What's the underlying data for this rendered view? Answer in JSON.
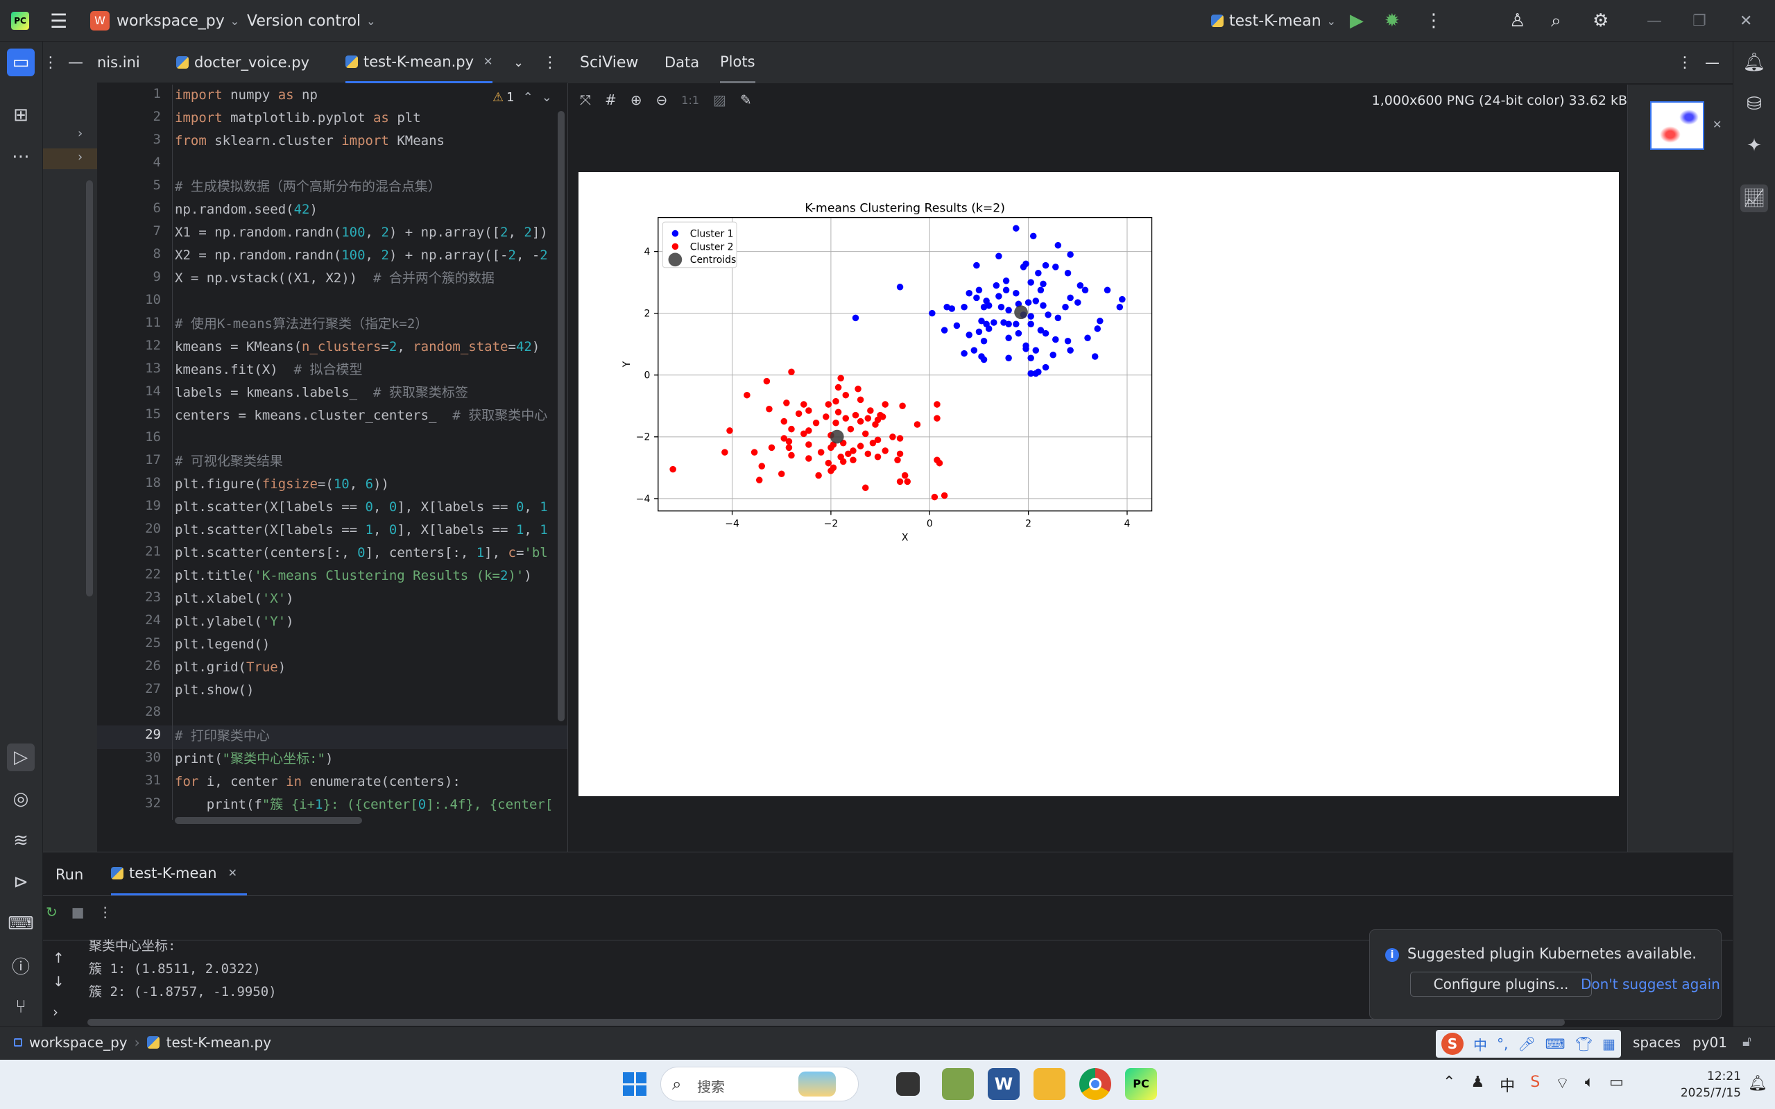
{
  "titlebar": {
    "project": "workspace_py",
    "project_badge": "W",
    "vcs": "Version control",
    "run_config": "test-K-mean"
  },
  "editor_tabs": [
    {
      "label": "nis.ini"
    },
    {
      "label": "docter_voice.py"
    },
    {
      "label": "test-K-mean.py"
    }
  ],
  "editor": {
    "warning_count": "1",
    "lines": [
      {
        "n": "1",
        "t": "import numpy as np"
      },
      {
        "n": "2",
        "t": "import matplotlib.pyplot as plt"
      },
      {
        "n": "3",
        "t": "from sklearn.cluster import KMeans"
      },
      {
        "n": "4",
        "t": ""
      },
      {
        "n": "5",
        "t": "# 生成模拟数据（两个高斯分布的混合点集）"
      },
      {
        "n": "6",
        "t": "np.random.seed(42)"
      },
      {
        "n": "7",
        "t": "X1 = np.random.randn(100, 2) + np.array([2, 2])"
      },
      {
        "n": "8",
        "t": "X2 = np.random.randn(100, 2) + np.array([-2, -2"
      },
      {
        "n": "9",
        "t": "X = np.vstack((X1, X2))  # 合并两个簇的数据"
      },
      {
        "n": "10",
        "t": ""
      },
      {
        "n": "11",
        "t": "# 使用K-means算法进行聚类（指定k=2）"
      },
      {
        "n": "12",
        "t": "kmeans = KMeans(n_clusters=2, random_state=42)"
      },
      {
        "n": "13",
        "t": "kmeans.fit(X)  # 拟合模型"
      },
      {
        "n": "14",
        "t": "labels = kmeans.labels_  # 获取聚类标签"
      },
      {
        "n": "15",
        "t": "centers = kmeans.cluster_centers_  # 获取聚类中心"
      },
      {
        "n": "16",
        "t": ""
      },
      {
        "n": "17",
        "t": "# 可视化聚类结果"
      },
      {
        "n": "18",
        "t": "plt.figure(figsize=(10, 6))"
      },
      {
        "n": "19",
        "t": "plt.scatter(X[labels == 0, 0], X[labels == 0, 1"
      },
      {
        "n": "20",
        "t": "plt.scatter(X[labels == 1, 0], X[labels == 1, 1"
      },
      {
        "n": "21",
        "t": "plt.scatter(centers[:, 0], centers[:, 1], c='bl"
      },
      {
        "n": "22",
        "t": "plt.title('K-means Clustering Results (k=2)')"
      },
      {
        "n": "23",
        "t": "plt.xlabel('X')"
      },
      {
        "n": "24",
        "t": "plt.ylabel('Y')"
      },
      {
        "n": "25",
        "t": "plt.legend()"
      },
      {
        "n": "26",
        "t": "plt.grid(True)"
      },
      {
        "n": "27",
        "t": "plt.show()"
      },
      {
        "n": "28",
        "t": ""
      },
      {
        "n": "29",
        "t": "# 打印聚类中心"
      },
      {
        "n": "30",
        "t": "print(\"聚类中心坐标:\")"
      },
      {
        "n": "31",
        "t": "for i, center in enumerate(centers):"
      },
      {
        "n": "32",
        "t": "    print(f\"簇 {i+1}: ({center[0]:.4f}, {center["
      }
    ]
  },
  "sciview": {
    "tabs": [
      "SciView",
      "Data",
      "Plots"
    ],
    "zoom_label": "1:1",
    "image_info": "1,000x600 PNG (24-bit color) 33.62 kB"
  },
  "chart_data": {
    "type": "scatter",
    "title": "K-means Clustering Results (k=2)",
    "xlabel": "X",
    "ylabel": "Y",
    "xlim": [
      -5.5,
      4.5
    ],
    "ylim": [
      -4.4,
      5.1
    ],
    "xticks": [
      -4,
      -2,
      0,
      2,
      4
    ],
    "yticks": [
      -4,
      -2,
      0,
      2,
      4
    ],
    "tick_labels_x": [
      "−4",
      "−2",
      "0",
      "2",
      "4"
    ],
    "tick_labels_y": [
      "−4",
      "−2",
      "0",
      "2",
      "4"
    ],
    "grid": true,
    "legend_position": "top-left",
    "series": [
      {
        "name": "Cluster 1",
        "color": "#0000ff",
        "points": [
          [
            1.75,
            4.75
          ],
          [
            2.1,
            4.5
          ],
          [
            2.6,
            4.2
          ],
          [
            2.85,
            3.9
          ],
          [
            1.4,
            3.85
          ],
          [
            1.95,
            3.6
          ],
          [
            2.35,
            3.55
          ],
          [
            2.55,
            3.5
          ],
          [
            0.95,
            3.55
          ],
          [
            1.9,
            3.5
          ],
          [
            2.2,
            3.3
          ],
          [
            2.8,
            3.3
          ],
          [
            1.55,
            3.05
          ],
          [
            2.05,
            3.0
          ],
          [
            2.3,
            2.95
          ],
          [
            3.05,
            2.9
          ],
          [
            1.35,
            2.9
          ],
          [
            3.15,
            2.75
          ],
          [
            3.6,
            2.75
          ],
          [
            1.0,
            2.75
          ],
          [
            1.55,
            2.75
          ],
          [
            2.25,
            2.75
          ],
          [
            1.75,
            2.65
          ],
          [
            0.8,
            2.65
          ],
          [
            1.4,
            2.55
          ],
          [
            2.85,
            2.5
          ],
          [
            0.95,
            2.5
          ],
          [
            1.15,
            2.4
          ],
          [
            2.15,
            2.4
          ],
          [
            2.0,
            2.35
          ],
          [
            3.0,
            2.35
          ],
          [
            1.8,
            2.3
          ],
          [
            1.2,
            2.25
          ],
          [
            2.3,
            2.25
          ],
          [
            0.7,
            2.2
          ],
          [
            1.1,
            2.2
          ],
          [
            0.35,
            2.2
          ],
          [
            1.45,
            2.2
          ],
          [
            2.75,
            2.2
          ],
          [
            0.45,
            2.15
          ],
          [
            3.85,
            2.2
          ],
          [
            1.6,
            2.1
          ],
          [
            3.9,
            2.45
          ],
          [
            0.05,
            2.0
          ],
          [
            1.9,
            1.95
          ],
          [
            2.4,
            1.95
          ],
          [
            2.05,
            1.9
          ],
          [
            2.6,
            1.85
          ],
          [
            1.05,
            1.75
          ],
          [
            1.3,
            1.7
          ],
          [
            1.6,
            1.65
          ],
          [
            1.75,
            1.65
          ],
          [
            2.05,
            1.65
          ],
          [
            3.45,
            1.75
          ],
          [
            1.15,
            1.65
          ],
          [
            1.5,
            1.7
          ],
          [
            0.55,
            1.6
          ],
          [
            1.2,
            1.5
          ],
          [
            2.25,
            1.45
          ],
          [
            0.3,
            1.45
          ],
          [
            1.0,
            1.4
          ],
          [
            1.8,
            1.35
          ],
          [
            2.35,
            1.35
          ],
          [
            3.4,
            1.5
          ],
          [
            0.8,
            1.3
          ],
          [
            1.6,
            1.2
          ],
          [
            2.55,
            1.15
          ],
          [
            1.1,
            1.1
          ],
          [
            2.8,
            1.1
          ],
          [
            3.2,
            1.2
          ],
          [
            1.95,
            0.95
          ],
          [
            0.9,
            0.8
          ],
          [
            1.95,
            0.85
          ],
          [
            2.15,
            0.8
          ],
          [
            2.85,
            0.8
          ],
          [
            0.7,
            0.7
          ],
          [
            1.05,
            0.6
          ],
          [
            2.5,
            0.65
          ],
          [
            3.35,
            0.6
          ],
          [
            1.6,
            0.55
          ],
          [
            2.05,
            0.55
          ],
          [
            1.1,
            0.5
          ],
          [
            2.35,
            0.25
          ],
          [
            2.2,
            0.1
          ],
          [
            2.05,
            0.05
          ],
          [
            2.15,
            0.05
          ],
          [
            -0.6,
            2.85
          ],
          [
            -1.5,
            1.85
          ]
        ]
      },
      {
        "name": "Cluster 2",
        "color": "#ff0000",
        "points": [
          [
            -2.8,
            0.1
          ],
          [
            -1.8,
            -0.1
          ],
          [
            -3.3,
            -0.2
          ],
          [
            -1.45,
            -0.45
          ],
          [
            -1.85,
            -0.4
          ],
          [
            -3.7,
            -0.65
          ],
          [
            -1.7,
            -0.65
          ],
          [
            -1.4,
            -0.8
          ],
          [
            -2.9,
            -0.9
          ],
          [
            -1.9,
            -0.85
          ],
          [
            -2.55,
            -0.95
          ],
          [
            -2.05,
            -0.95
          ],
          [
            -0.9,
            -0.95
          ],
          [
            0.15,
            -0.95
          ],
          [
            -0.55,
            -1.0
          ],
          [
            -3.25,
            -1.1
          ],
          [
            -2.45,
            -1.15
          ],
          [
            -1.2,
            -1.15
          ],
          [
            -1.85,
            -1.2
          ],
          [
            -2.65,
            -1.25
          ],
          [
            -1.5,
            -1.3
          ],
          [
            -1.0,
            -1.3
          ],
          [
            -2.1,
            -1.35
          ],
          [
            -1.7,
            -1.4
          ],
          [
            -1.25,
            -1.4
          ],
          [
            -1.05,
            -1.45
          ],
          [
            -0.95,
            -1.35
          ],
          [
            -1.4,
            -1.5
          ],
          [
            -2.95,
            -1.5
          ],
          [
            -2.3,
            -1.55
          ],
          [
            -1.9,
            -1.55
          ],
          [
            -1.1,
            -1.6
          ],
          [
            -0.25,
            -1.6
          ],
          [
            0.15,
            -1.4
          ],
          [
            -4.05,
            -1.8
          ],
          [
            -2.8,
            -1.75
          ],
          [
            -2.45,
            -1.8
          ],
          [
            -1.6,
            -1.75
          ],
          [
            -2.55,
            -1.9
          ],
          [
            -2.95,
            -2.05
          ],
          [
            -2.0,
            -1.95
          ],
          [
            -1.3,
            -1.9
          ],
          [
            -0.75,
            -2.0
          ],
          [
            -0.6,
            -2.05
          ],
          [
            -1.05,
            -2.1
          ],
          [
            -2.85,
            -2.15
          ],
          [
            -1.75,
            -2.2
          ],
          [
            -1.15,
            -2.2
          ],
          [
            -2.45,
            -2.25
          ],
          [
            -1.95,
            -2.25
          ],
          [
            -2.0,
            -2.35
          ],
          [
            -1.4,
            -2.3
          ],
          [
            -3.2,
            -2.35
          ],
          [
            -2.85,
            -2.35
          ],
          [
            -1.55,
            -2.45
          ],
          [
            -0.9,
            -2.45
          ],
          [
            -1.65,
            -2.55
          ],
          [
            -1.25,
            -2.55
          ],
          [
            -4.15,
            -2.5
          ],
          [
            -3.55,
            -2.5
          ],
          [
            -2.2,
            -2.5
          ],
          [
            -2.8,
            -2.6
          ],
          [
            -2.45,
            -2.7
          ],
          [
            -1.8,
            -2.65
          ],
          [
            -1.55,
            -2.75
          ],
          [
            -1.75,
            -2.8
          ],
          [
            -1.05,
            -2.65
          ],
          [
            -0.6,
            -2.55
          ],
          [
            -2.05,
            -2.85
          ],
          [
            -1.95,
            -3.0
          ],
          [
            -0.65,
            -2.75
          ],
          [
            0.15,
            -2.75
          ],
          [
            0.2,
            -2.85
          ],
          [
            -3.4,
            -2.95
          ],
          [
            -2.0,
            -3.1
          ],
          [
            -3.0,
            -3.2
          ],
          [
            -2.25,
            -3.25
          ],
          [
            -0.5,
            -3.25
          ],
          [
            -3.45,
            -3.4
          ],
          [
            -0.6,
            -3.45
          ],
          [
            -0.45,
            -3.45
          ],
          [
            -1.3,
            -3.65
          ],
          [
            -5.2,
            -3.05
          ],
          [
            0.1,
            -3.95
          ],
          [
            0.3,
            -3.9
          ]
        ]
      }
    ],
    "centroids": {
      "name": "Centroids",
      "color": "#3a3a3a",
      "points": [
        [
          1.8511,
          2.0322
        ],
        [
          -1.8757,
          -1.995
        ]
      ]
    }
  },
  "run": {
    "tab_label": "Run",
    "config_tab": "test-K-mean",
    "output": [
      "聚类中心坐标:",
      "簇 1: (1.8511, 2.0322)",
      "簇 2: (-1.8757, -1.9950)"
    ]
  },
  "notification": {
    "message": "Suggested plugin Kubernetes available.",
    "primary": "Configure plugins...",
    "secondary": "Don't suggest again"
  },
  "statusbar": {
    "crumb1": "workspace_py",
    "crumb2": "test-K-mean.py",
    "indent": "spaces",
    "interpreter": "py01"
  },
  "taskbar": {
    "search_placeholder": "搜索",
    "time": "12:21",
    "date": "2025/7/15",
    "ime": "中"
  },
  "colors": {
    "accent": "#3574f0",
    "run_green": "#5fb865",
    "bg": "#1e1f22",
    "panel": "#2b2d30"
  }
}
